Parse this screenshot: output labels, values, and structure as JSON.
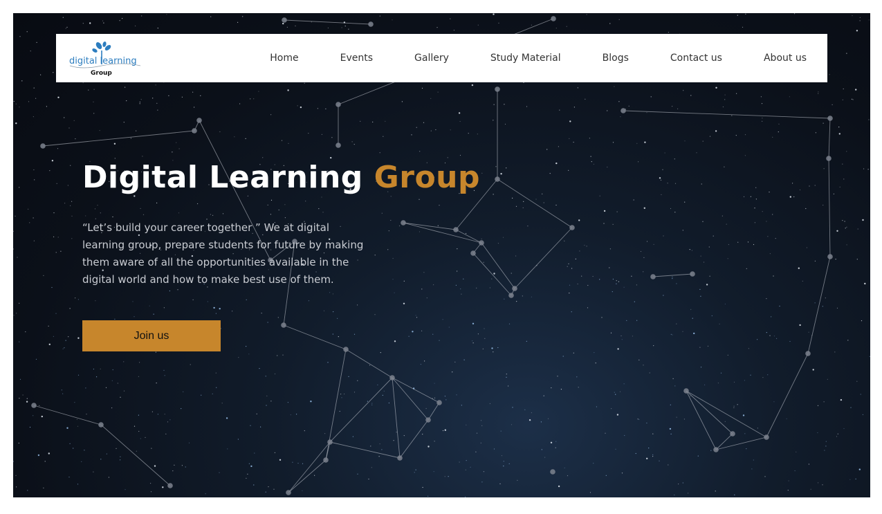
{
  "brand": {
    "logo_line1": "digital learning",
    "logo_line2": "Group",
    "logo_icon": "sprout-icon",
    "logo_color": "#2c7dbf"
  },
  "nav": {
    "items": [
      {
        "label": "Home"
      },
      {
        "label": "Events"
      },
      {
        "label": "Gallery"
      },
      {
        "label": "Study Material"
      },
      {
        "label": "Blogs"
      },
      {
        "label": "Contact us"
      },
      {
        "label": "About us"
      }
    ]
  },
  "hero": {
    "title_main": "Digital Learning ",
    "title_accent": "Group",
    "description": "“Let’s build your career together ” We at digital learning group, prepare students for future by making them aware of all the opportunities available in the digital world and how to make best use of them.",
    "cta_label": "Join us",
    "accent_color": "#c7862c",
    "background": "starfield-constellation"
  }
}
